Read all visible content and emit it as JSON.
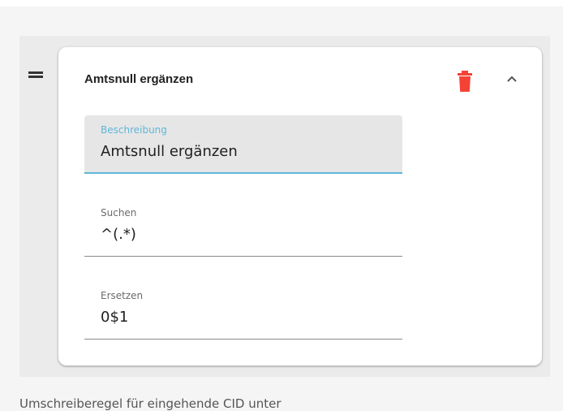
{
  "rule": {
    "title": "Amtsnull ergänzen",
    "fields": [
      {
        "label": "Beschreibung",
        "value": "Amtsnull ergänzen"
      },
      {
        "label": "Suchen",
        "value": "^(.*)"
      },
      {
        "label": "Ersetzen",
        "value": "0$1"
      }
    ]
  },
  "footer": {
    "text": "Umschreiberegel für eingehende CID unter"
  },
  "colors": {
    "accent": "#5eb6d9",
    "delete": "#f44336"
  },
  "icons": {
    "drag": "drag-handle-icon",
    "delete": "trash-icon",
    "collapse": "chevron-up-icon"
  }
}
